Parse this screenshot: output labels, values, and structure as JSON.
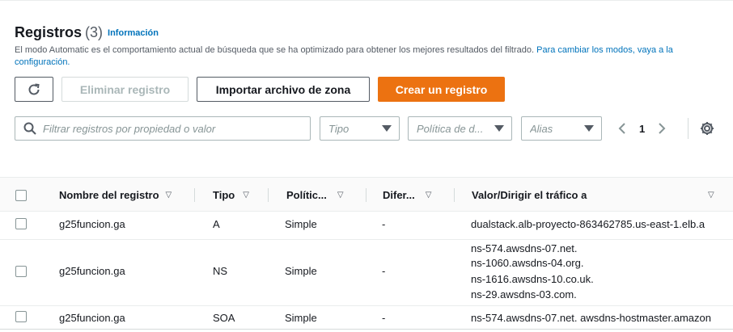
{
  "header": {
    "title": "Registros",
    "count": "(3)",
    "info_link": "Información",
    "description": "El modo Automatic es el comportamiento actual de búsqueda que se ha optimizado para obtener los mejores resultados del filtrado.",
    "description_link": "Para cambiar los modos, vaya a la configuración."
  },
  "toolbar": {
    "refresh_icon": "refresh-icon",
    "delete_label": "Eliminar registro",
    "import_label": "Importar archivo de zona",
    "create_label": "Crear un registro",
    "create_color": "#ec7211"
  },
  "filters": {
    "search_placeholder": "Filtrar registros por propiedad o valor",
    "type_placeholder": "Tipo",
    "policy_placeholder": "Política de d...",
    "alias_placeholder": "Alias"
  },
  "pagination": {
    "current_page": "1"
  },
  "table": {
    "columns": [
      "Nombre del registro",
      "Tipo",
      "Polític...",
      "Difer...",
      "Valor/Dirigir el tráfico a"
    ],
    "rows": [
      {
        "name": "g25funcion.ga",
        "type": "A",
        "policy": "Simple",
        "diff": "-",
        "value": [
          "dualstack.alb-proyecto-863462785.us-east-1.elb.a"
        ]
      },
      {
        "name": "g25funcion.ga",
        "type": "NS",
        "policy": "Simple",
        "diff": "-",
        "value": [
          "ns-574.awsdns-07.net.",
          "ns-1060.awsdns-04.org.",
          "ns-1616.awsdns-10.co.uk.",
          "ns-29.awsdns-03.com."
        ]
      },
      {
        "name": "g25funcion.ga",
        "type": "SOA",
        "policy": "Simple",
        "diff": "-",
        "value": [
          "ns-574.awsdns-07.net. awsdns-hostmaster.amazon"
        ]
      }
    ]
  }
}
